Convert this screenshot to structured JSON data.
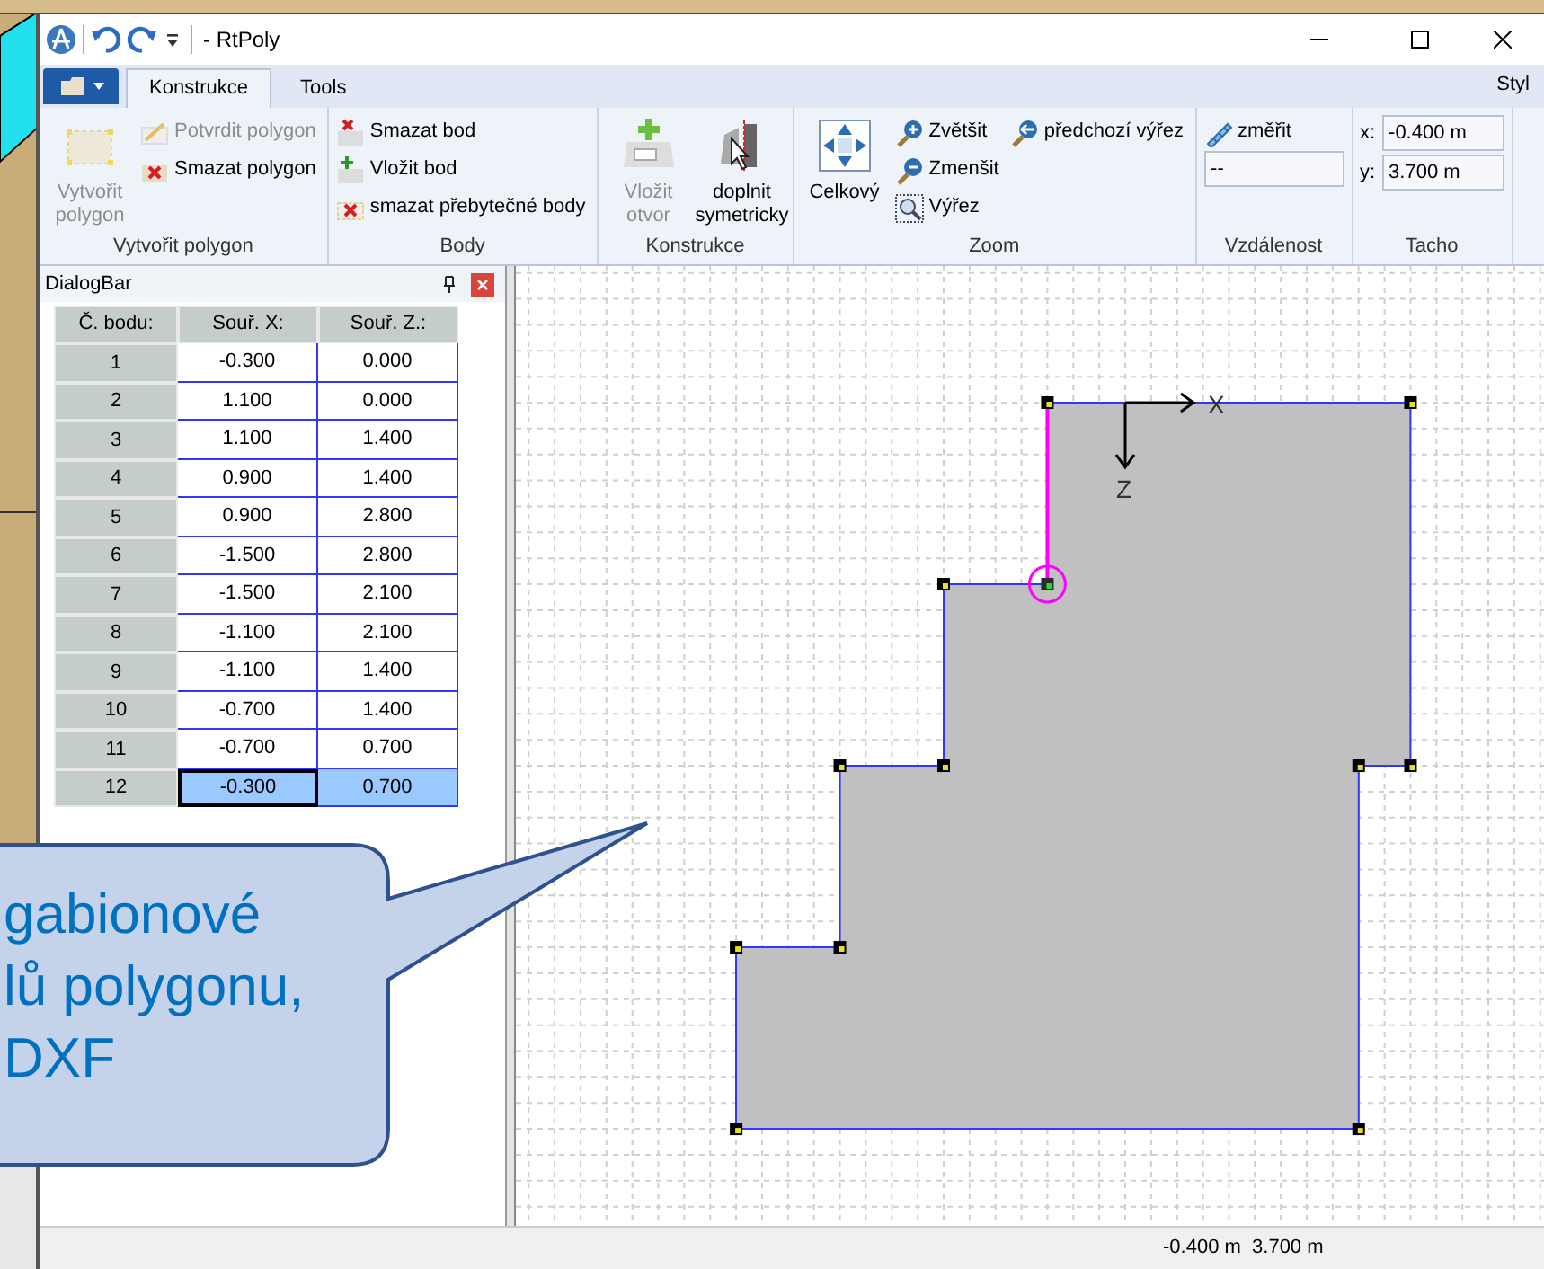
{
  "window": {
    "title": "- RtPoly"
  },
  "ribbon": {
    "tabs": [
      {
        "label": "Konstrukce",
        "selected": true
      },
      {
        "label": "Tools",
        "selected": false
      }
    ],
    "style_menu": "Styl",
    "groups": [
      {
        "label": "Vytvořit polygon",
        "columns": [
          [
            {
              "kind": "large",
              "label": "Vytvořit polygon",
              "disabled": true
            }
          ],
          [
            {
              "kind": "small",
              "label": "Potvrdit polygon",
              "disabled": true
            },
            {
              "kind": "small",
              "label": "Smazat polygon",
              "disabled": false
            }
          ]
        ]
      },
      {
        "label": "Body",
        "columns": [
          [
            {
              "kind": "small",
              "label": "Smazat bod",
              "disabled": false
            },
            {
              "kind": "small",
              "label": "Vložit bod",
              "disabled": false
            },
            {
              "kind": "small",
              "label": "smazat přebytečné body",
              "disabled": false
            }
          ]
        ]
      },
      {
        "label": "Konstrukce",
        "columns": [
          [
            {
              "kind": "large",
              "label": "Vložit otvor",
              "disabled": true
            }
          ],
          [
            {
              "kind": "large",
              "label": "doplnit symetricky",
              "disabled": false
            }
          ]
        ]
      },
      {
        "label": "Zoom",
        "columns": [
          [
            {
              "kind": "large",
              "label": "Celkový",
              "disabled": false
            }
          ],
          [
            {
              "kind": "small",
              "label": "Zvětšit",
              "disabled": false
            },
            {
              "kind": "small",
              "label": "Zmenšit",
              "disabled": false
            },
            {
              "kind": "small",
              "label": "Výřez",
              "disabled": false
            }
          ],
          [
            {
              "kind": "small",
              "label": "předchozí výřez",
              "disabled": false
            }
          ]
        ]
      },
      {
        "label": "Vzdálenost",
        "columns": [
          [
            {
              "kind": "small",
              "label": "změřit",
              "disabled": false
            },
            {
              "kind": "field",
              "value": "--"
            }
          ]
        ]
      },
      {
        "label": "Tacho",
        "columns": [
          [
            {
              "kind": "labeled_field",
              "label": "x:",
              "value": "-0.400 m"
            },
            {
              "kind": "labeled_field",
              "label": "y:",
              "value": "3.700 m"
            }
          ]
        ]
      }
    ]
  },
  "panel": {
    "title": "DialogBar"
  },
  "table": {
    "columns": [
      "Č. bodu:",
      "Souř. X:",
      "Souř. Z.:"
    ],
    "rows": [
      {
        "cells": [
          "1",
          "-0.300",
          "0.000"
        ],
        "selected": false
      },
      {
        "cells": [
          "2",
          "1.100",
          "0.000"
        ],
        "selected": false
      },
      {
        "cells": [
          "3",
          "1.100",
          "1.400"
        ],
        "selected": false
      },
      {
        "cells": [
          "4",
          "0.900",
          "1.400"
        ],
        "selected": false
      },
      {
        "cells": [
          "5",
          "0.900",
          "2.800"
        ],
        "selected": false
      },
      {
        "cells": [
          "6",
          "-1.500",
          "2.800"
        ],
        "selected": false
      },
      {
        "cells": [
          "7",
          "-1.500",
          "2.100"
        ],
        "selected": false
      },
      {
        "cells": [
          "8",
          "-1.100",
          "2.100"
        ],
        "selected": false
      },
      {
        "cells": [
          "9",
          "-1.100",
          "1.400"
        ],
        "selected": false
      },
      {
        "cells": [
          "10",
          "-0.700",
          "1.400"
        ],
        "selected": false
      },
      {
        "cells": [
          "11",
          "-0.700",
          "0.700"
        ],
        "selected": false
      },
      {
        "cells": [
          "12",
          "-0.300",
          "0.700"
        ],
        "selected": true
      }
    ]
  },
  "canvas": {
    "axis_x": "X",
    "axis_z": "Z"
  },
  "status_bar": {
    "coordinates": "-0.400 m  3.700 m"
  },
  "callout": {
    "lines": [
      "gabionové",
      "lů polygonu,",
      "DXF"
    ]
  }
}
